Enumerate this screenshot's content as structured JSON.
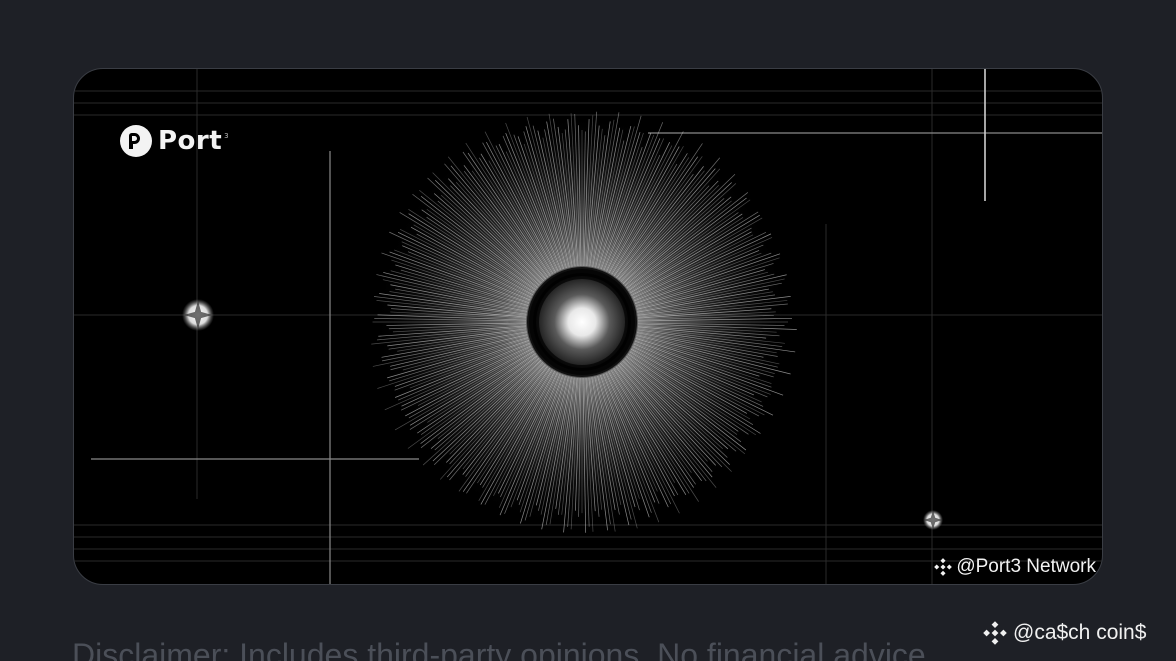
{
  "banner": {
    "logo_text": "Port",
    "logo_superscript": "3",
    "watermark_text": "@Port3 Network",
    "watermark_icon": "binance-icon"
  },
  "page": {
    "watermark_text": "@ca$ch coin$",
    "watermark_icon": "binance-icon",
    "disclaimer": "Disclaimer: Includes third-party opinions. No financial advice."
  },
  "colors": {
    "background": "#1e2026",
    "card_background": "#000000",
    "disclaimer_text": "#4b4f58"
  }
}
